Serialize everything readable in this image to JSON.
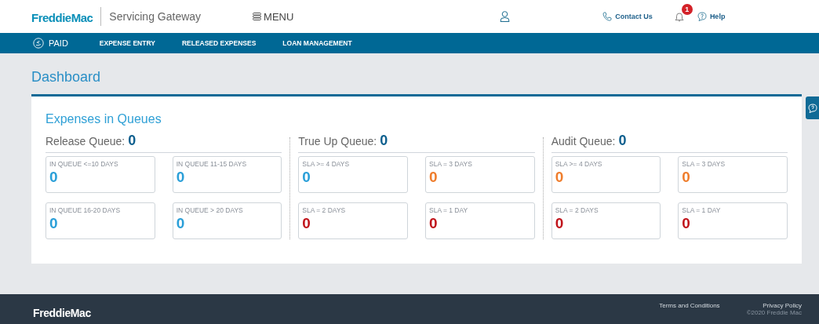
{
  "header": {
    "logo": "FreddieMac",
    "app_title": "Servicing Gateway",
    "menu": "MENU",
    "contact": "Contact Us",
    "notifications": "1",
    "help": "Help"
  },
  "nav": {
    "brand": "PAID",
    "items": [
      {
        "label": "EXPENSE ENTRY",
        "selected": false
      },
      {
        "label": "RELEASED EXPENSES",
        "selected": false
      },
      {
        "label": "LOAN MANAGEMENT",
        "selected": false
      }
    ]
  },
  "page_title": "Dashboard",
  "card_title": "Expenses in Queues",
  "queues": [
    {
      "name": "Release Queue:",
      "count": "0",
      "tiles": [
        {
          "label": "IN QUEUE <=10 DAYS",
          "value": "0",
          "color": "#2a9fd8"
        },
        {
          "label": "IN QUEUE 11-15 DAYS",
          "value": "0",
          "color": "#2a9fd8"
        },
        {
          "label": "IN QUEUE 16-20 DAYS",
          "value": "0",
          "color": "#2a9fd8"
        },
        {
          "label": "IN QUEUE > 20 DAYS",
          "value": "0",
          "color": "#2a9fd8"
        }
      ]
    },
    {
      "name": "True Up Queue:",
      "count": "0",
      "tiles": [
        {
          "label": "SLA >= 4 DAYS",
          "value": "0",
          "color": "#2a9fd8"
        },
        {
          "label": "SLA = 3 DAYS",
          "value": "0",
          "color": "#ef7d2c"
        },
        {
          "label": "SLA = 2 DAYS",
          "value": "0",
          "color": "#c0141b"
        },
        {
          "label": "SLA = 1 DAY",
          "value": "0",
          "color": "#c0141b"
        }
      ]
    },
    {
      "name": "Audit Queue:",
      "count": "0",
      "tiles": [
        {
          "label": "SLA >= 4 DAYS",
          "value": "0",
          "color": "#ef7d2c"
        },
        {
          "label": "SLA = 3 DAYS",
          "value": "0",
          "color": "#ef7d2c"
        },
        {
          "label": "SLA = 2 DAYS",
          "value": "0",
          "color": "#c0141b"
        },
        {
          "label": "SLA = 1 DAY",
          "value": "0",
          "color": "#c0141b"
        }
      ]
    }
  ],
  "footer": {
    "logo": "FreddieMac",
    "links": [
      "Terms and Conditions",
      "Privacy Policy"
    ],
    "copyright": "©2020 Freddie Mac"
  }
}
